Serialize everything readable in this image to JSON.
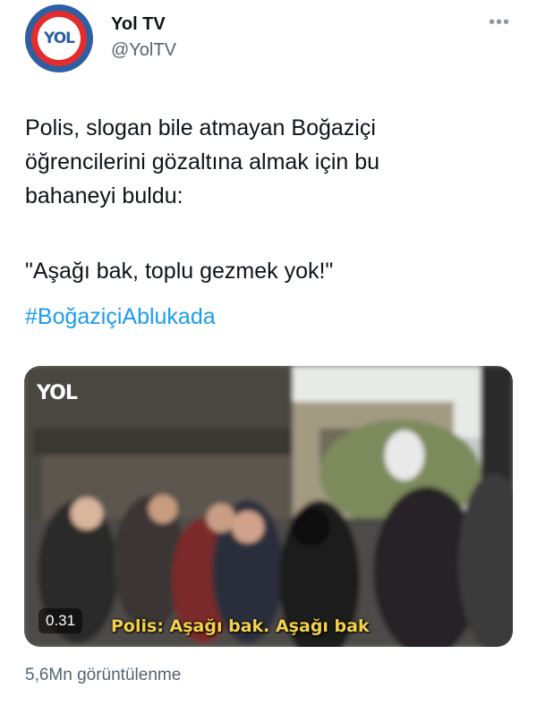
{
  "account": {
    "name": "Yol TV",
    "handle": "@YolTV",
    "avatar_text": "YOL"
  },
  "tweet": {
    "line1": "Polis, slogan bile atmayan Boğaziçi",
    "line2": "öğrencilerini gözaltına almak için bu",
    "line3": "bahaneyi buldu:",
    "quote": "\"Aşağı bak, toplu gezmek yok!\"",
    "hashtag": "#BoğaziçiAblukada"
  },
  "video": {
    "watermark": "YOL",
    "duration": "0.31",
    "subtitle": "Polis: Aşağı bak. Aşağı bak"
  },
  "stats": {
    "views": "5,6Mn görüntülenme"
  },
  "icons": {
    "more": "more-horizontal-icon"
  },
  "colors": {
    "hashtag": "#1d9bf0",
    "subtitle": "#f3d24a",
    "secondary_text": "#536471"
  }
}
